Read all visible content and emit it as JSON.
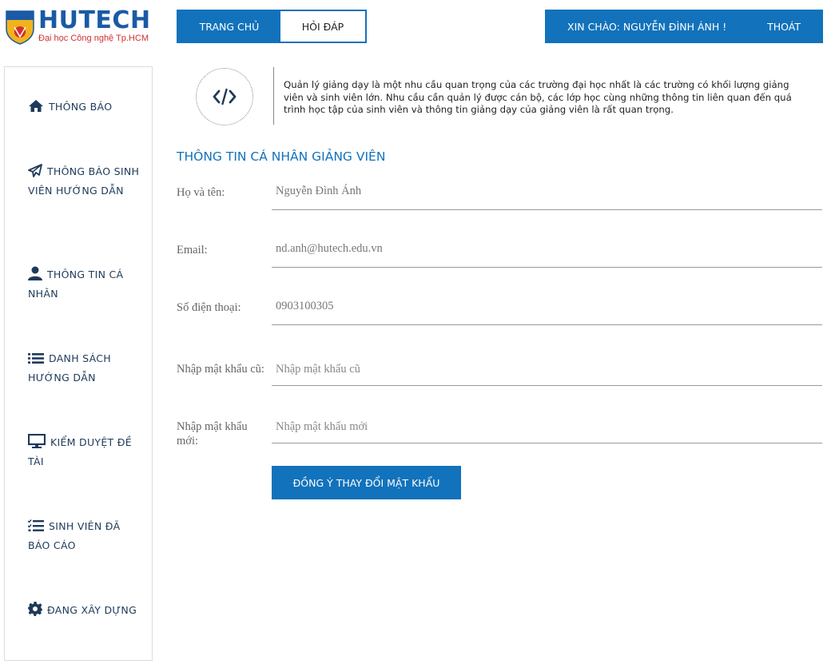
{
  "logo": {
    "title": "HUTECH",
    "subtitle": "Đại học Công nghệ Tp.HCM",
    "shield_text": "HUTECH"
  },
  "nav": {
    "home": "TRANG CHỦ",
    "qa": "HỎI ĐÁP"
  },
  "user": {
    "greeting": "XIN CHÀO: NGUYỄN ĐÌNH ÁNH !",
    "logout": "THOÁT"
  },
  "sidebar": {
    "items": [
      {
        "label": "THÔNG BÁO",
        "icon": "home-icon"
      },
      {
        "label": "THÔNG BÁO SINH VIÊN HƯỚNG DẪN",
        "icon": "paper-plane-icon"
      },
      {
        "label": "THÔNG TIN CÁ NHÂN",
        "icon": "user-icon"
      },
      {
        "label": "DANH SÁCH HƯỚNG DẪN",
        "icon": "list-icon"
      },
      {
        "label": "KIỂM DUYỆT ĐỀ TÀI",
        "icon": "monitor-icon"
      },
      {
        "label": "SINH VIÊN ĐÃ BÁO CÁO",
        "icon": "checklist-icon"
      },
      {
        "label": "ĐANG XÂY DỰNG",
        "icon": "gear-icon"
      }
    ]
  },
  "intro": {
    "icon": "code-icon",
    "text": "Quản lý giảng dạy là một nhu cầu quan trọng của các trường đại học nhất là các trường có khối lượng giảng viên và sinh viên lớn. Nhu cầu cần quản lý được cán bộ, các lớp học cùng những thông tin liên quan đến quá trình học tập của sinh viên và thông tin giảng dạy của giảng viên là rất quan trọng."
  },
  "section_title": "THÔNG TIN CÁ NHÂN GIẢNG VIÊN",
  "form": {
    "name_label": "Họ và tên:",
    "name_value": "Nguyễn Đình Ánh",
    "email_label": "Email:",
    "email_value": "nd.anh@hutech.edu.vn",
    "phone_label": "Số điện thoại:",
    "phone_value": "0903100305",
    "old_pw_label": "Nhập mật khẩu cũ:",
    "old_pw_placeholder": "Nhập mật khẩu cũ",
    "new_pw_label": "Nhập mật khẩu mới:",
    "new_pw_placeholder": "Nhập mật khẩu mới",
    "submit": "ĐỒNG Ý THAY ĐỔI MẬT KHẨU"
  },
  "colors": {
    "primary": "#1272bb",
    "sidebar_text": "#1e3a5a",
    "logo_red": "#d32f2f"
  }
}
